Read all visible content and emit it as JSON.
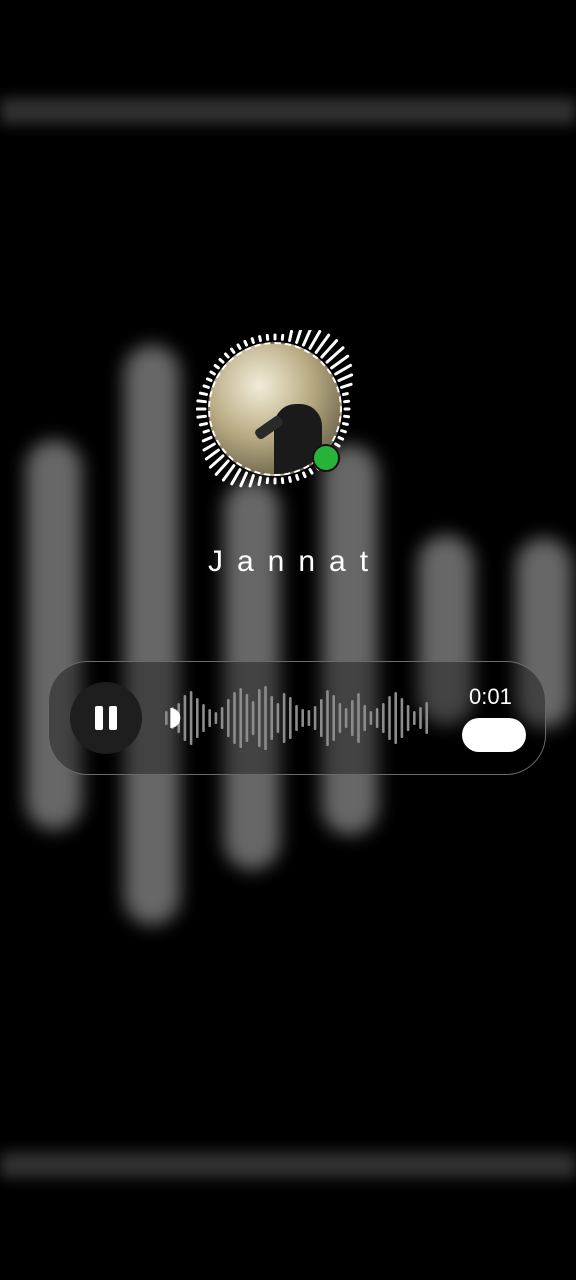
{
  "contact": {
    "name": "Jannat"
  },
  "player": {
    "elapsed": "0:01",
    "state": "playing",
    "progress": 0.02
  },
  "icons": {
    "pause": "pause-icon",
    "online": "online-status-icon"
  },
  "colors": {
    "background": "#000000",
    "online": "#27b33a",
    "accent": "#ffffff"
  }
}
